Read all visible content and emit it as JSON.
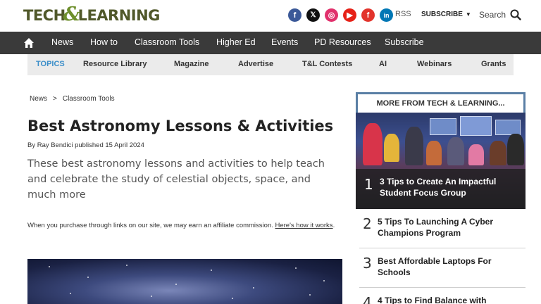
{
  "header": {
    "logo_left": "TECH",
    "logo_amp": "&",
    "logo_right": "LEARNING",
    "socials": [
      {
        "name": "facebook-icon",
        "glyph": "f"
      },
      {
        "name": "x-icon",
        "glyph": "𝕏"
      },
      {
        "name": "instagram-icon",
        "glyph": "◎"
      },
      {
        "name": "youtube-icon",
        "glyph": "▶"
      },
      {
        "name": "flipboard-icon",
        "glyph": "f"
      },
      {
        "name": "linkedin-icon",
        "glyph": "in"
      }
    ],
    "rss": "RSS",
    "subscribe": "SUBSCRIBE",
    "search": "Search"
  },
  "mainnav": {
    "items": [
      "News",
      "How to",
      "Classroom Tools",
      "Higher Ed",
      "Events",
      "PD Resources",
      "Subscribe"
    ]
  },
  "topics": {
    "label": "TOPICS",
    "items": [
      "Resource Library",
      "Magazine",
      "Advertise",
      "T&L Contests",
      "AI",
      "Webinars",
      "Grants"
    ]
  },
  "article": {
    "breadcrumb": [
      "News",
      ">",
      "Classroom Tools"
    ],
    "title": "Best Astronomy Lessons & Activities",
    "byline_prefix": "By",
    "author": "Ray Bendici",
    "published_label": "published",
    "date": "15 April 2024",
    "standfirst": "These best astronomy lessons and activities to help teach and celebrate the study of celestial objects, space, and much more",
    "affiliate_text": "When you purchase through links on our site, we may earn an affiliate commission. ",
    "affiliate_link": "Here's how it works",
    "affiliate_end": "."
  },
  "sidebar": {
    "heading": "MORE FROM TECH & LEARNING...",
    "items": [
      {
        "num": "1",
        "title": "3 Tips to Create An Impactful Student Focus Group"
      },
      {
        "num": "2",
        "title": "5 Tips To Launching A Cyber Champions Program"
      },
      {
        "num": "3",
        "title": "Best Affordable Laptops For Schools"
      },
      {
        "num": "4",
        "title": "4 Tips to Find Balance with"
      }
    ]
  },
  "colors": {
    "nav_bg": "#3a3a3a",
    "topics_label": "#3b8ec9",
    "sidebar_border": "#5a7fa5",
    "logo_text": "#50582a"
  }
}
